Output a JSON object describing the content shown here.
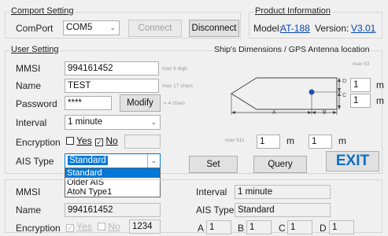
{
  "comport": {
    "legend": "Comport Setting",
    "label": "ComPort",
    "port": "COM5",
    "connect": "Connect",
    "disconnect": "Disconnect"
  },
  "product": {
    "legend": "Product Information",
    "model_label": "Model:",
    "model_value": "AT-188",
    "version_label": "Version:",
    "version_value": "V3.01"
  },
  "user": {
    "legend": "User Setting",
    "mmsi_label": "MMSI",
    "mmsi_value": "994161452",
    "mmsi_hint": "max 9 digit",
    "name_label": "Name",
    "name_value": "TEST",
    "name_hint": "max 17 chars",
    "password_label": "Password",
    "password_value": "****",
    "modify": "Modify",
    "password_hint": "= 4 chars",
    "interval_label": "Interval",
    "interval_value": "1 minute",
    "encryption_label": "Encryption",
    "yes": "Yes",
    "no": "No",
    "yes_checked": false,
    "no_checked": true,
    "ais_type_label": "AIS Type",
    "ais_type_value": "Standard",
    "ais_options": [
      "Standard",
      "Older AIS",
      "AtoN Type1"
    ],
    "set": "Set",
    "query": "Query",
    "exit": "EXIT"
  },
  "dimensions": {
    "title": "Ship's Dimensions / GPS Antenna location",
    "max53": "max 53",
    "max511": "max 511",
    "d_value": "1",
    "c_value": "1",
    "a_value": "1",
    "b_value": "1",
    "unit": "m",
    "letters": {
      "a": "A",
      "b": "B",
      "c": "C",
      "d": "D"
    }
  },
  "status": {
    "mmsi_label": "MMSI",
    "name_label": "Name",
    "name_value": "994161452",
    "encryption_label": "Encryption",
    "yes": "Yes",
    "no": "No",
    "code": "1234",
    "interval_label": "Interval",
    "interval_value": "1 minute",
    "ais_type_label": "AIS Type",
    "ais_type_value": "Standard",
    "a_label": "A",
    "a_value": "1",
    "b_label": "B",
    "b_value": "1",
    "c_label": "C",
    "c_value": "1",
    "d_label": "D",
    "d_value": "1"
  },
  "colors": {
    "accent": "#0078d7",
    "link": "#0645ad",
    "exit_text": "#0a6fc2",
    "gps_dot": "#1f4fbf"
  }
}
